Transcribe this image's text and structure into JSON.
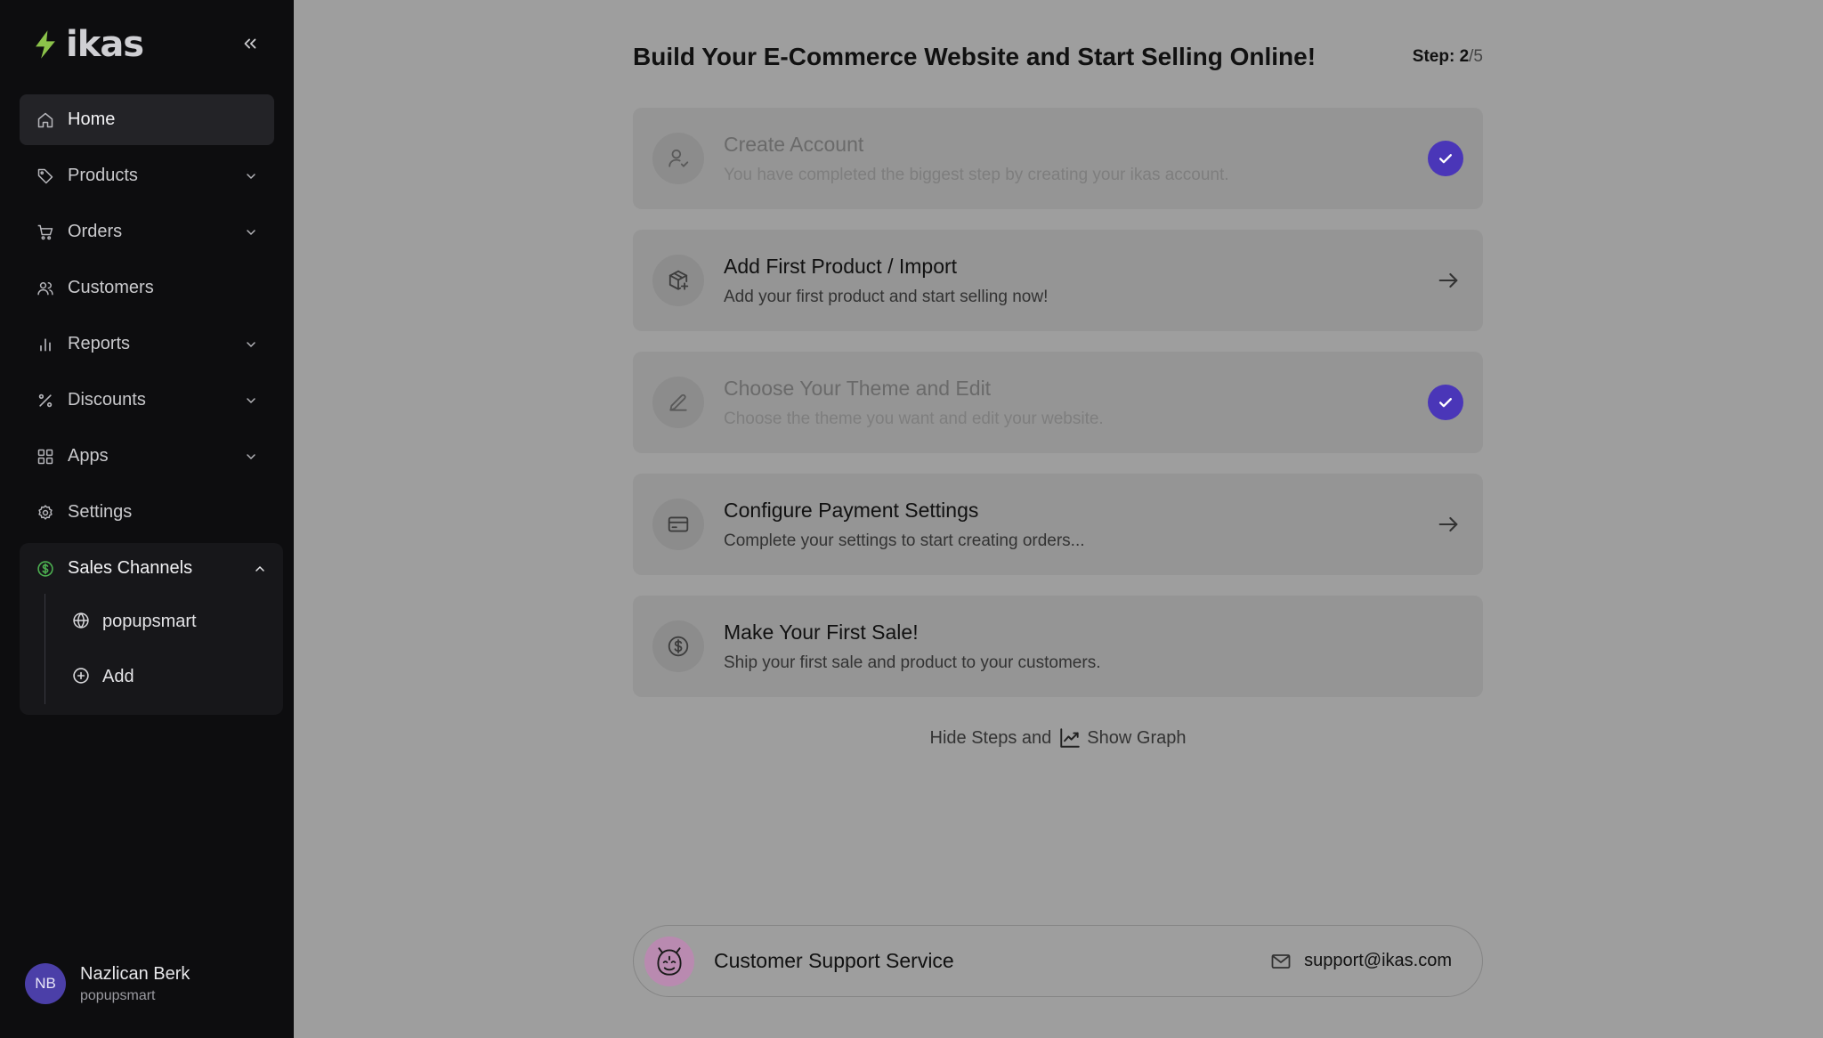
{
  "brand": {
    "name": "ikas",
    "accent": "#8bc34a"
  },
  "sidebar": {
    "collapse_icon": "chevrons-left-icon",
    "items": [
      {
        "key": "home",
        "label": "Home",
        "icon": "home-icon",
        "active": true
      },
      {
        "key": "products",
        "label": "Products",
        "icon": "tag-icon",
        "expandable": true
      },
      {
        "key": "orders",
        "label": "Orders",
        "icon": "cart-icon",
        "expandable": true
      },
      {
        "key": "customers",
        "label": "Customers",
        "icon": "users-icon"
      },
      {
        "key": "reports",
        "label": "Reports",
        "icon": "bar-chart-icon",
        "expandable": true
      },
      {
        "key": "discounts",
        "label": "Discounts",
        "icon": "percent-icon",
        "expandable": true
      },
      {
        "key": "apps",
        "label": "Apps",
        "icon": "grid-icon",
        "expandable": true
      },
      {
        "key": "settings",
        "label": "Settings",
        "icon": "gear-icon"
      }
    ],
    "sales_channels": {
      "label": "Sales Channels",
      "icon": "dollar-circle-icon",
      "accent": "#4caf50",
      "sub_items": [
        {
          "label": "popupsmart",
          "icon": "globe-icon"
        },
        {
          "label": "Add",
          "icon": "plus-circle-icon"
        }
      ]
    },
    "user": {
      "initials": "NB",
      "name": "Nazlican Berk",
      "store": "popupsmart"
    }
  },
  "main": {
    "title": "Build Your E-Commerce Website and Start Selling Online!",
    "step_prefix": "Step: ",
    "step_current": "2",
    "step_total": "/5",
    "steps": [
      {
        "title": "Create Account",
        "desc": "You have completed the biggest step by creating your ikas account.",
        "icon": "user-check-icon",
        "status": "done"
      },
      {
        "title": "Add First Product / Import",
        "desc": "Add your first product and start selling now!",
        "icon": "package-plus-icon",
        "status": "todo"
      },
      {
        "title": "Choose Your Theme and Edit",
        "desc": "Choose the theme you want and edit your website.",
        "icon": "pencil-icon",
        "status": "done"
      },
      {
        "title": "Configure Payment Settings",
        "desc": "Complete your settings to start creating orders...",
        "icon": "credit-card-icon",
        "status": "todo"
      },
      {
        "title": "Make Your First Sale!",
        "desc": "Ship your first sale and product to your customers.",
        "icon": "dollar-circle-icon",
        "status": "pending"
      }
    ],
    "toggle": {
      "hide_text": "Hide Steps and",
      "graph_text": "Show Graph",
      "icon": "trending-up-icon"
    },
    "support": {
      "title": "Customer Support Service",
      "email": "support@ikas.com",
      "mail_icon": "mail-icon"
    }
  },
  "colors": {
    "check": "#4a36b8",
    "avatar": "#4b3fa8",
    "sidebar_bg": "#0d0d0f"
  }
}
